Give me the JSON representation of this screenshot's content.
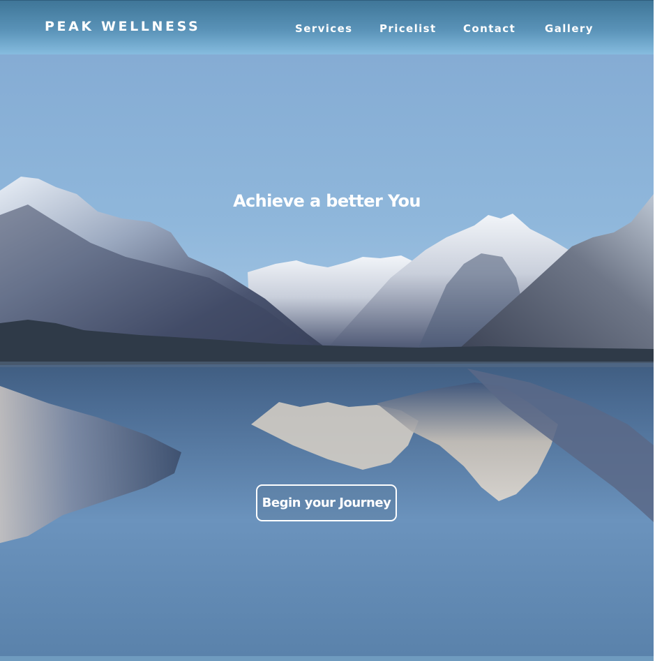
{
  "header": {
    "brand": "PEAK WELLNESS",
    "nav": [
      {
        "label": "Services"
      },
      {
        "label": "Pricelist"
      },
      {
        "label": "Contact"
      },
      {
        "label": "Gallery"
      }
    ]
  },
  "hero": {
    "headline": "Achieve a better You",
    "cta_label": "Begin your Journey",
    "background_image": "mountain-lake-reflection"
  },
  "colors": {
    "header_top": "#3f7698",
    "header_bottom": "#86bcdf",
    "sky": "#88b0d6",
    "water": "#5e82a8",
    "text": "#ffffff"
  }
}
